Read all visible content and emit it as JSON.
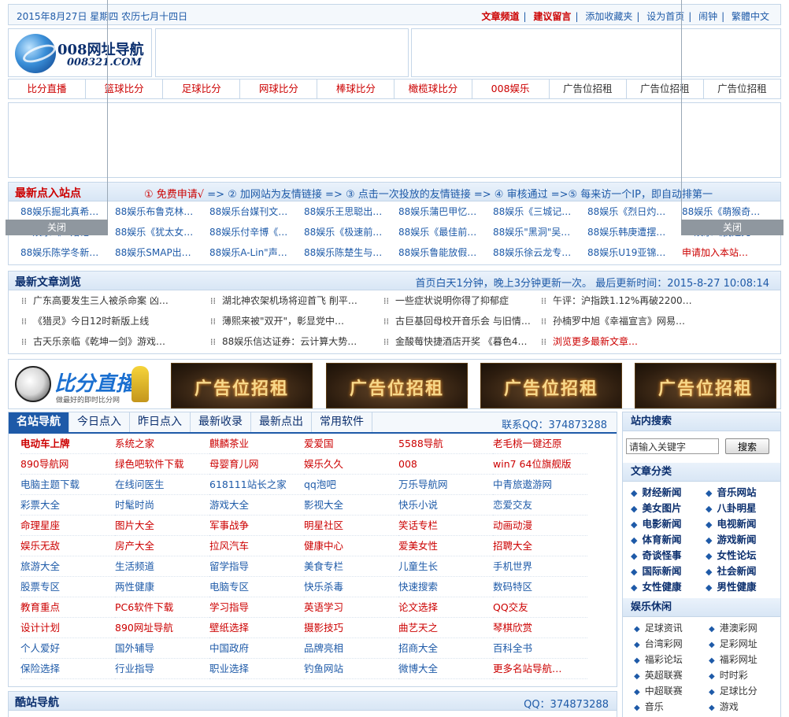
{
  "topbar": {
    "date": "2015年8月27日  星期四  农历七月十四日",
    "links": [
      "文章频道",
      "建议留言",
      "添加收藏夹",
      "设为首页",
      "闹钟",
      "繁體中文"
    ]
  },
  "logo": {
    "title": "008网址导航",
    "domain": "008321.COM"
  },
  "nav": [
    "比分直播",
    "篮球比分",
    "足球比分",
    "网球比分",
    "棒球比分",
    "橄榄球比分",
    "008娱乐",
    "广告位招租",
    "广告位招租",
    "广告位招租"
  ],
  "float": {
    "close_label": "关闭"
  },
  "sites": {
    "title": "最新点入站点",
    "steps": {
      "s1": "① 免费申请√",
      "s2": " => ② 加网站为友情链接 => ③ 点击一次投放的友情链接 => ④ 审核通过 =>⑤ 每来访一个IP，即自动排第一"
    },
    "rows": [
      [
        "88娱乐掘北真希…",
        "88娱乐布鲁克林…",
        "88娱乐台媒刊文…",
        "88娱乐王思聪出…",
        "88娱乐蒲巴甲忆…",
        "88娱乐《三城记…",
        "88娱乐《烈日灼…",
        "88娱乐《萌猴奇…"
      ],
      [
        "88娱乐《二婚记…",
        "88娱乐《犹太女…",
        "88娱乐付辛博《…",
        "88娱乐《极速前…",
        "88娱乐《最佳前…",
        "88娱乐\"黑洞\"吴…",
        "88娱乐韩庚遭摆…",
        "88娱乐《我是先…"
      ],
      [
        "88娱乐陈学冬新…",
        "88娱乐SMAP出…",
        "88娱乐A-Lin\"声…",
        "88娱乐陈楚生与…",
        "88娱乐鲁能放假…",
        "88娱乐徐云龙专…",
        "88娱乐U19亚锦…",
        "申请加入本站…"
      ]
    ]
  },
  "articles": {
    "title": "最新文章浏览",
    "info": "首页白天1分钟，晚上3分钟更新一次。  最后更新时间：2015-8-27 10:08:14",
    "rows": [
      [
        "广东高要发生三人被杀命案 凶…",
        "湖北神农架机场将迎首飞 削平…",
        "一些症状说明你得了抑郁症",
        "午评：沪指跌1.12%再破2200…"
      ],
      [
        "《猎灵》今日12时新版上线",
        "薄熙来被\"双开\"，彰显党中…",
        "古巨基回母校开音乐会 与旧情…",
        "孙楠罗中旭《幸福宣言》网易…"
      ],
      [
        "古天乐亲临《乾坤一剑》游戏…",
        "88娱乐信达证券：云计算大势…",
        "金酸莓快捷酒店开奖 《暮色4…",
        "浏览更多最新文章…"
      ]
    ]
  },
  "banners": {
    "bifen_text": "比分直播",
    "bifen_sub": "做最好的即时比分网",
    "ads": [
      "广告位招租",
      "广告位招租",
      "广告位招租",
      "广告位招租"
    ]
  },
  "famous": {
    "tabs": [
      "名站导航",
      "今日点入",
      "昨日点入",
      "最新收录",
      "最新点出",
      "常用软件"
    ],
    "qq": "联系QQ：374873288",
    "rows": [
      [
        "电动车上牌",
        "系统之家",
        "麒麟茶业",
        "爱爱国",
        "5588导航",
        "老毛桃一键还原"
      ],
      [
        "890导航网",
        "绿色吧软件下载",
        "母婴育儿网",
        "娱乐久久",
        "008",
        "win7 64位旗舰版"
      ],
      [
        "电脑主题下载",
        "在线问医生",
        "618111站长之家",
        "qq泡吧",
        "万乐导航网",
        "中青旅遨游网"
      ],
      [
        "彩票大全",
        "时髦时尚",
        "游戏大全",
        "影视大全",
        "快乐小说",
        "恋爱交友"
      ],
      [
        "命理星座",
        "图片大全",
        "军事战争",
        "明星社区",
        "笑话专栏",
        "动画动漫"
      ],
      [
        "娱乐无敌",
        "房产大全",
        "拉风汽车",
        "健康中心",
        "爱美女性",
        "招聘大全"
      ],
      [
        "旅游大全",
        "生活频道",
        "留学指导",
        "美食专栏",
        "儿童生长",
        "手机世界"
      ],
      [
        "股票专区",
        "两性健康",
        "电脑专区",
        "快乐杀毒",
        "快速搜索",
        "数码特区"
      ],
      [
        "教育重点",
        "PC6软件下载",
        "学习指导",
        "英语学习",
        "论文选择",
        "QQ交友"
      ],
      [
        "设计计划",
        "890网址导航",
        "壁纸选择",
        "摄影技巧",
        "曲艺天之",
        "琴棋欣赏"
      ],
      [
        "个人爱好",
        "国外辅导",
        "中国政府",
        "品牌亮相",
        "招商大全",
        "百科全书"
      ],
      [
        "保险选择",
        "行业指导",
        "职业选择",
        "钓鱼网站",
        "微博大全",
        "更多名站导航…"
      ]
    ]
  },
  "cool": {
    "title": "酷站导航",
    "qq": "QQ：374873288"
  },
  "side": {
    "search_title": "站内搜索",
    "search_placeholder": "请输入关键字",
    "search_button": "搜索",
    "cat_title": "文章分类",
    "cats": [
      "财经新闻",
      "音乐网站",
      "美女图片",
      "八卦明星",
      "电影新闻",
      "电视新闻",
      "体育新闻",
      "游戏新闻",
      "奇谈怪事",
      "女性论坛",
      "国际新闻",
      "社会新闻",
      "女性健康",
      "男性健康"
    ],
    "leisure_title": "娱乐休闲",
    "leisure": [
      "足球资讯",
      "港澳彩网",
      "台湾彩网",
      "足彩网址",
      "福彩论坛",
      "福彩网址",
      "英超联赛",
      "时时彩",
      "中超联赛",
      "足球比分",
      "音乐",
      "游戏"
    ]
  }
}
